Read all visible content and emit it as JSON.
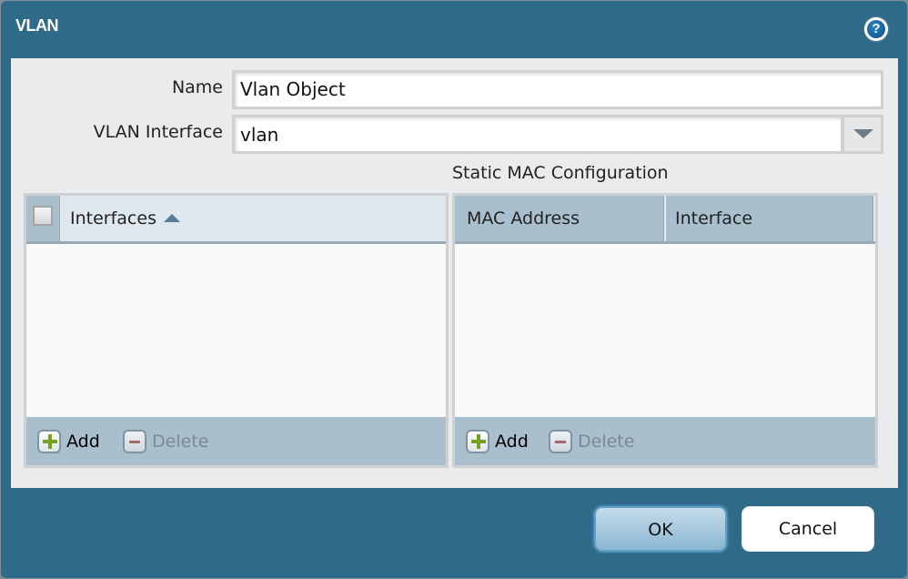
{
  "dialog": {
    "title": "VLAN",
    "help_icon": "?"
  },
  "form": {
    "name_label": "Name",
    "name_value": "Vlan Object",
    "vlan_interface_label": "VLAN Interface",
    "vlan_interface_value": "vlan"
  },
  "interfaces_grid": {
    "columns": [
      "Interfaces"
    ],
    "sort": "ascending",
    "rows": [],
    "add_label": "Add",
    "delete_label": "Delete"
  },
  "static_mac": {
    "section_title": "Static MAC Configuration",
    "columns": [
      "MAC Address",
      "Interface"
    ],
    "rows": [],
    "add_label": "Add",
    "delete_label": "Delete"
  },
  "footer": {
    "ok_label": "OK",
    "cancel_label": "Cancel"
  }
}
